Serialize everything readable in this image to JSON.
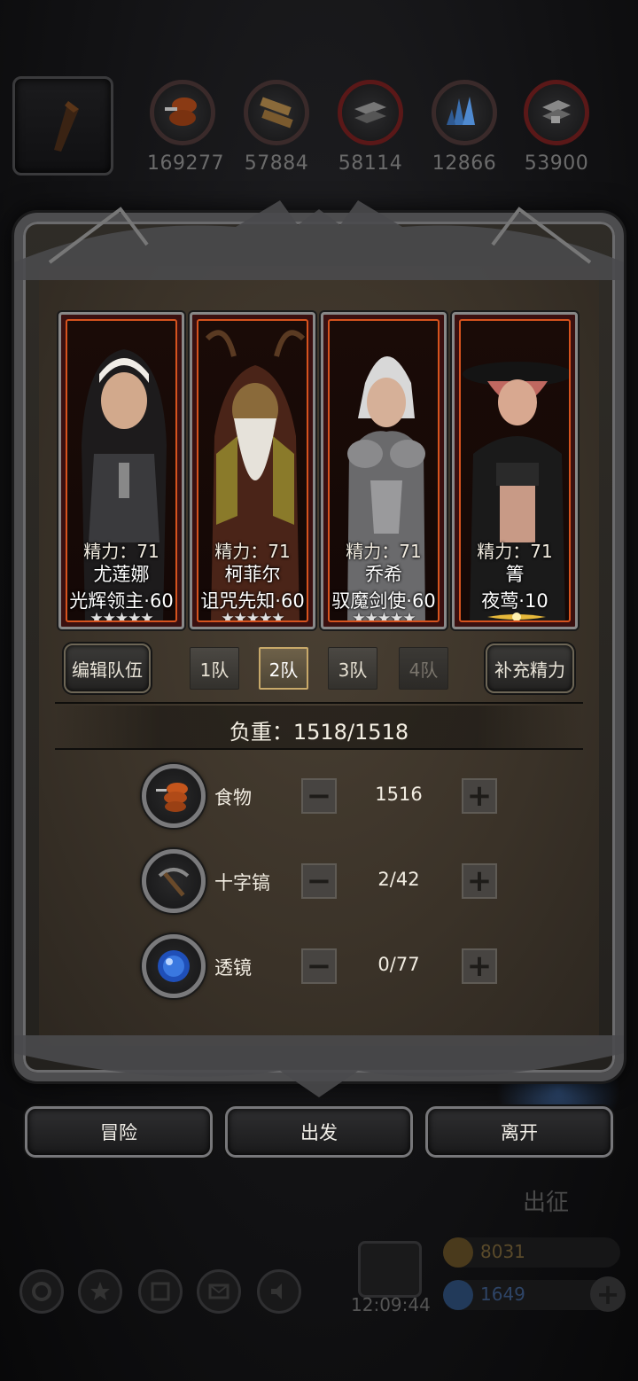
{
  "resources": [
    {
      "icon": "meat-icon",
      "value": "169277"
    },
    {
      "icon": "wood-icon",
      "value": "57884"
    },
    {
      "icon": "iron-icon",
      "value": "58114"
    },
    {
      "icon": "crystal-icon",
      "value": "12866"
    },
    {
      "icon": "ore-icon",
      "value": "53900"
    }
  ],
  "heroes": [
    {
      "energy": "精力：71",
      "name": "尤莲娜",
      "title": "光辉领主·60",
      "stars": "★★★★★"
    },
    {
      "energy": "精力：71",
      "name": "柯菲尔",
      "title": "诅咒先知·60",
      "stars": "★★★★★"
    },
    {
      "energy": "精力：71",
      "name": "乔希",
      "title": "驭魔剑使·60",
      "stars": "★★★★★"
    },
    {
      "energy": "精力：71",
      "name": "箐",
      "title": "夜莺·10",
      "stars": ""
    }
  ],
  "team": {
    "edit_label": "编辑队伍",
    "refill_label": "补充精力",
    "tabs": [
      "1队",
      "2队",
      "3队",
      "4队"
    ],
    "active_index": 1
  },
  "load": {
    "text": "负重：1518/1518"
  },
  "supplies": [
    {
      "label": "食物",
      "value": "1516",
      "icon": "meat-icon"
    },
    {
      "label": "十字镐",
      "value": "2/42",
      "icon": "pickaxe-icon"
    },
    {
      "label": "透镜",
      "value": "0/77",
      "icon": "lens-icon"
    }
  ],
  "actions": {
    "adventure": "冒险",
    "depart": "出发",
    "leave": "离开"
  },
  "background": {
    "expedition": "出征",
    "time": "12:09:44",
    "gold": "8031",
    "gems": "1649"
  },
  "colors": {
    "accent_orange": "#d6531e",
    "active_tab_border": "#c8a96a",
    "panel": "#3a3228"
  }
}
